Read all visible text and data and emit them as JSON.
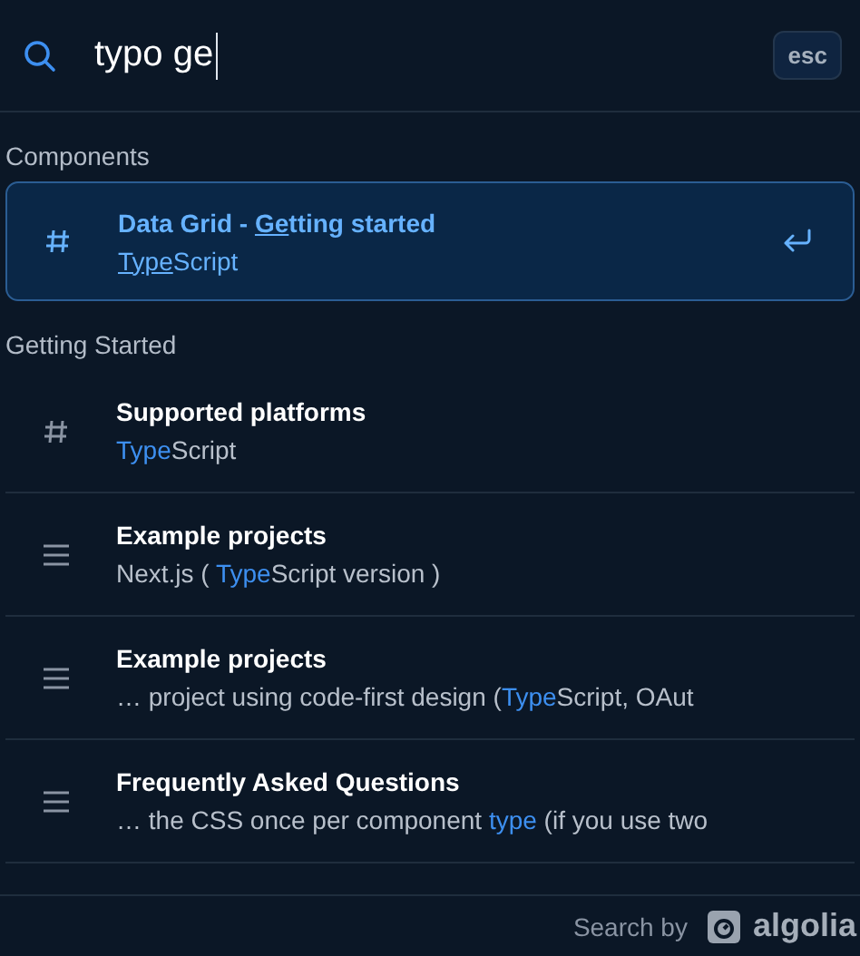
{
  "search": {
    "value": "typo ge",
    "esc": "esc"
  },
  "sections": [
    {
      "label": "Components",
      "hits": [
        {
          "kind": "hash",
          "selected": true,
          "title": [
            {
              "text": "Data Grid - ",
              "match": false
            },
            {
              "text": "Ge",
              "match": true
            },
            {
              "text": "tting started",
              "match": false
            }
          ],
          "subtitle": [
            {
              "text": "Type",
              "match": true
            },
            {
              "text": "Script",
              "match": false
            }
          ]
        }
      ]
    },
    {
      "label": "Getting Started",
      "hits": [
        {
          "kind": "hash",
          "selected": false,
          "title": [
            {
              "text": "Supported platforms",
              "match": false
            }
          ],
          "subtitle": [
            {
              "text": "Type",
              "match": true
            },
            {
              "text": "Script",
              "match": false
            }
          ]
        },
        {
          "kind": "lines",
          "selected": false,
          "title": [
            {
              "text": "Example projects",
              "match": false
            }
          ],
          "subtitle": [
            {
              "text": "Next.js ( ",
              "match": false
            },
            {
              "text": "Type",
              "match": true
            },
            {
              "text": "Script version )",
              "match": false
            }
          ]
        },
        {
          "kind": "lines",
          "selected": false,
          "title": [
            {
              "text": "Example projects",
              "match": false
            }
          ],
          "subtitle": [
            {
              "text": "… project using code-first design (",
              "match": false
            },
            {
              "text": "Type",
              "match": true
            },
            {
              "text": "Script, OAut",
              "match": false
            }
          ]
        },
        {
          "kind": "lines",
          "selected": false,
          "title": [
            {
              "text": "Frequently Asked Questions",
              "match": false
            }
          ],
          "subtitle": [
            {
              "text": "… the CSS once per component ",
              "match": false
            },
            {
              "text": "type",
              "match": true
            },
            {
              "text": " (if you use two",
              "match": false
            }
          ]
        }
      ]
    }
  ],
  "footer": {
    "label": "Search by",
    "brand": "algolia"
  }
}
